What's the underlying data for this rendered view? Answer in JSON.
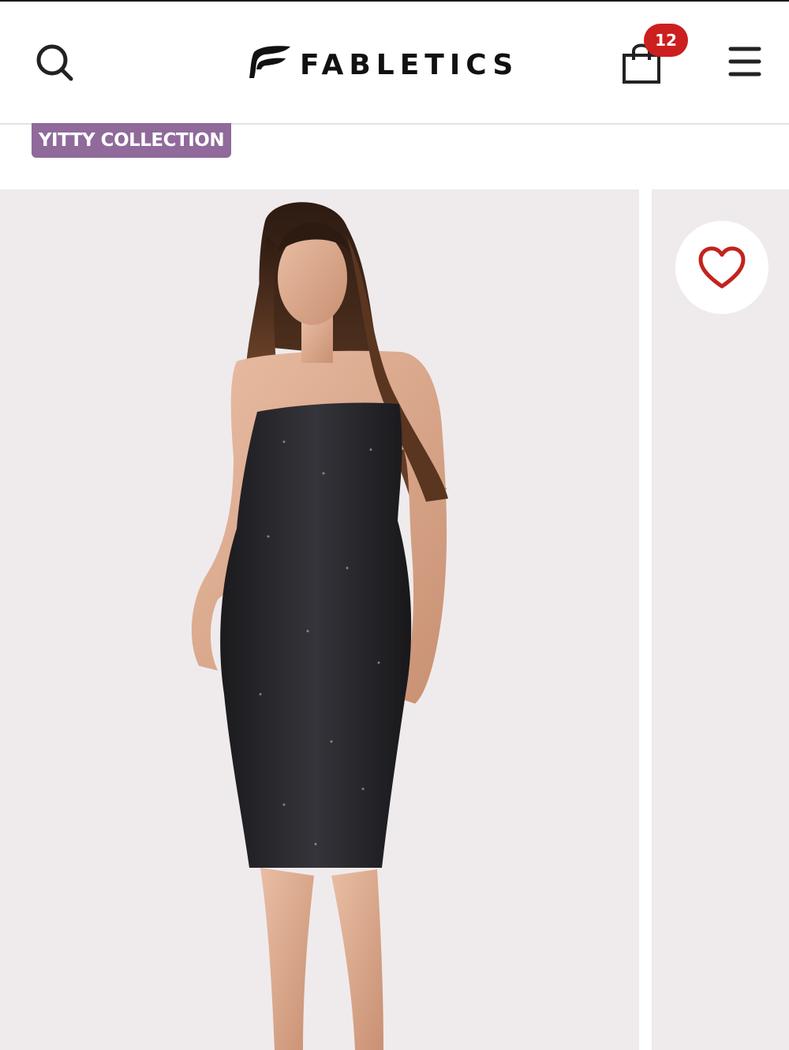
{
  "header": {
    "brand": "FABLETICS",
    "cart_count": "12",
    "icons": {
      "search": "search-icon",
      "cart": "shopping-bag-icon",
      "menu": "hamburger-menu-icon",
      "logo": "fabletics-logo-mark"
    }
  },
  "product": {
    "collection_badge": "YITTY COLLECTION",
    "favorite_icon": "heart-outline-icon",
    "image_alt": "Model wearing black shimmer strapless midi dress"
  },
  "colors": {
    "badge_purple": "#8f6a9a",
    "cart_badge_red": "#cc1f1f",
    "heart_red": "#c3231f",
    "image_background": "#efebec"
  }
}
